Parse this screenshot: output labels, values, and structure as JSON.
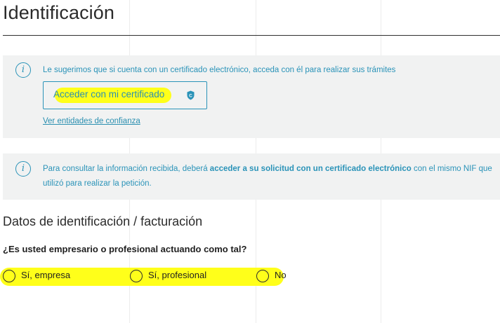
{
  "page": {
    "title": "Identificación"
  },
  "certificate_notice": {
    "text": "Le sugerimos que si cuenta con un certificado electrónico, acceda con él para realizar sus trámites",
    "button_label": "Acceder con mi certificado",
    "button_icon": "shield-c-icon",
    "trust_link": "Ver entidades de confianza"
  },
  "consult_notice": {
    "text_before": "Para consultar la información recibida, deberá ",
    "text_bold": "acceder a su solicitud con un certificado electrónico",
    "text_after": " con el mismo NIF que utilizó para realizar la petición."
  },
  "billing": {
    "section_title": "Datos de identificación / facturación",
    "question": "¿Es usted empresario o profesional actuando como tal?",
    "options": [
      {
        "label": "Sí, empresa"
      },
      {
        "label": "Sí, profesional"
      },
      {
        "label": "No"
      }
    ]
  },
  "colors": {
    "accent": "#2a93b8",
    "highlight": "#ffff1a",
    "panel_bg": "#f1f2f2"
  }
}
